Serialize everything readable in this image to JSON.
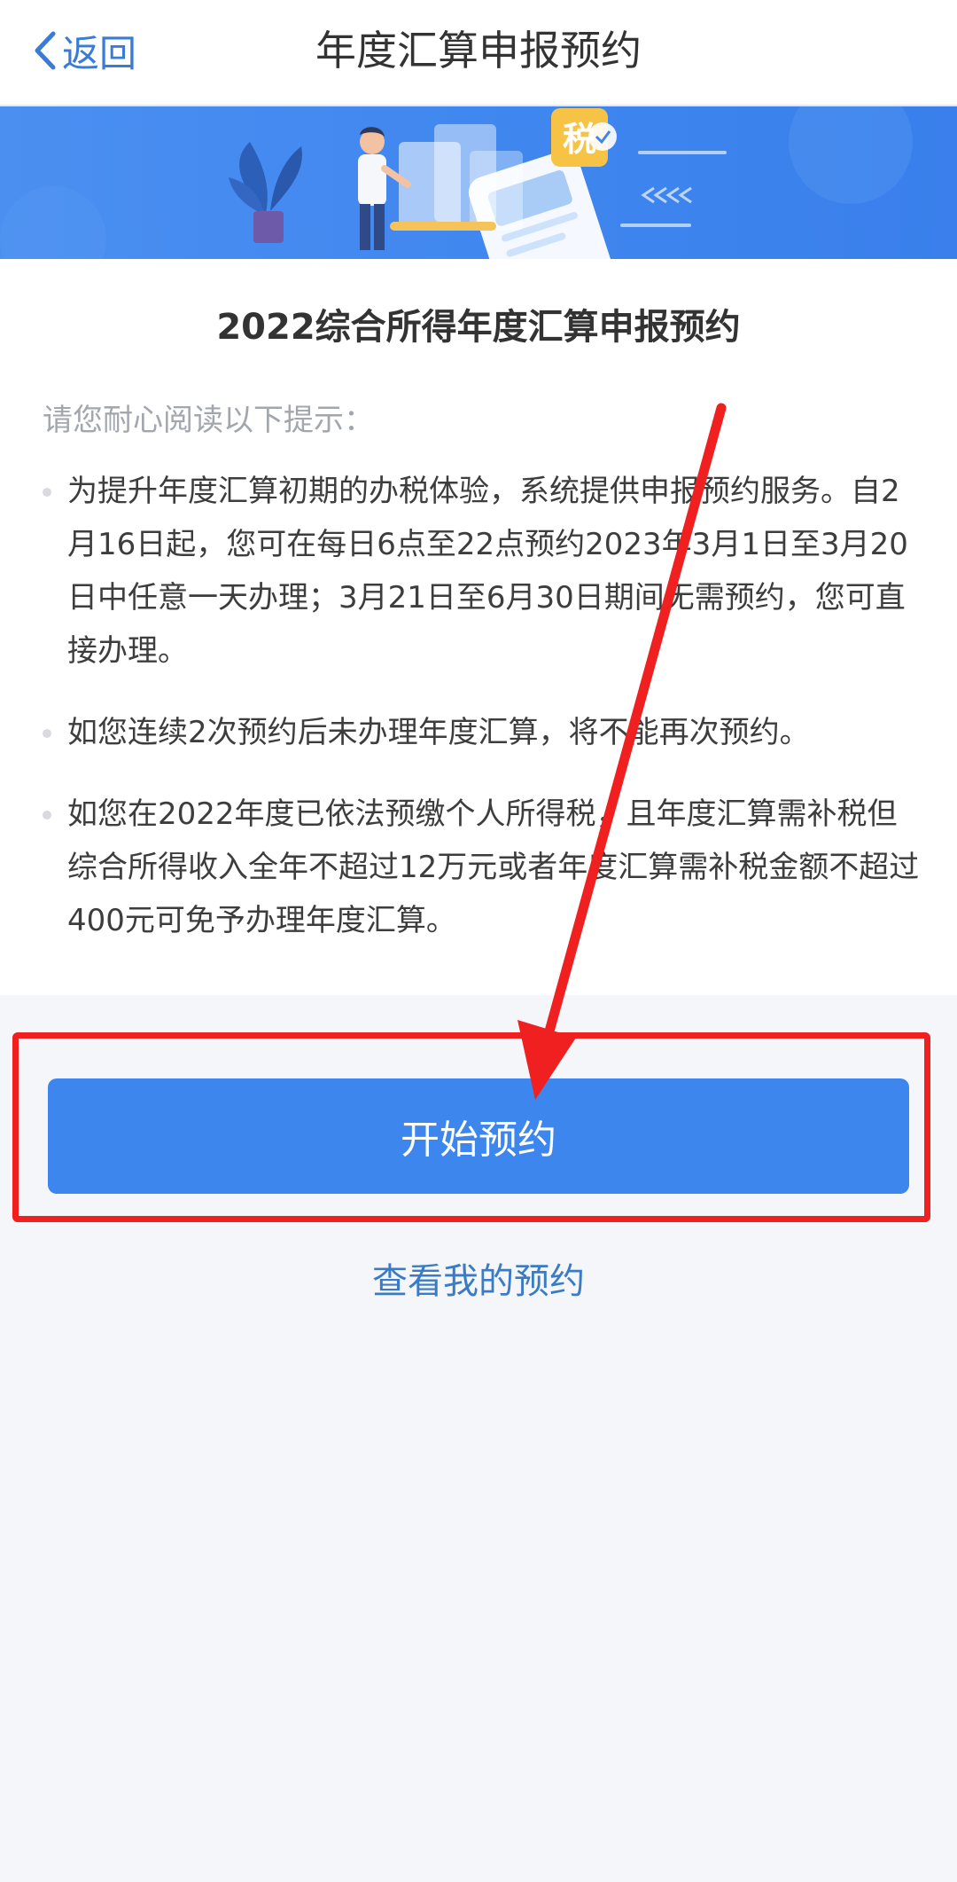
{
  "nav": {
    "back_label": "返回",
    "title": "年度汇算申报预约"
  },
  "banner": {
    "tax_badge": "税"
  },
  "card": {
    "title": "2022综合所得年度汇算申报预约",
    "intro": "请您耐心阅读以下提示：",
    "tips": [
      "为提升年度汇算初期的办税体验，系统提供申报预约服务。自2月16日起，您可在每日6点至22点预约2023年3月1日至3月20日中任意一天办理；3月21日至6月30日期间无需预约，您可直接办理。",
      "如您连续2次预约后未办理年度汇算，将不能再次预约。",
      "如您在2022年度已依法预缴个人所得税，且年度汇算需补税但综合所得收入全年不超过12万元或者年度汇算需补税金额不超过400元可免予办理年度汇算。"
    ]
  },
  "actions": {
    "start_label": "开始预约",
    "view_label": "查看我的预约"
  },
  "colors": {
    "accent": "#3d86ee",
    "annotation": "#f12020"
  }
}
